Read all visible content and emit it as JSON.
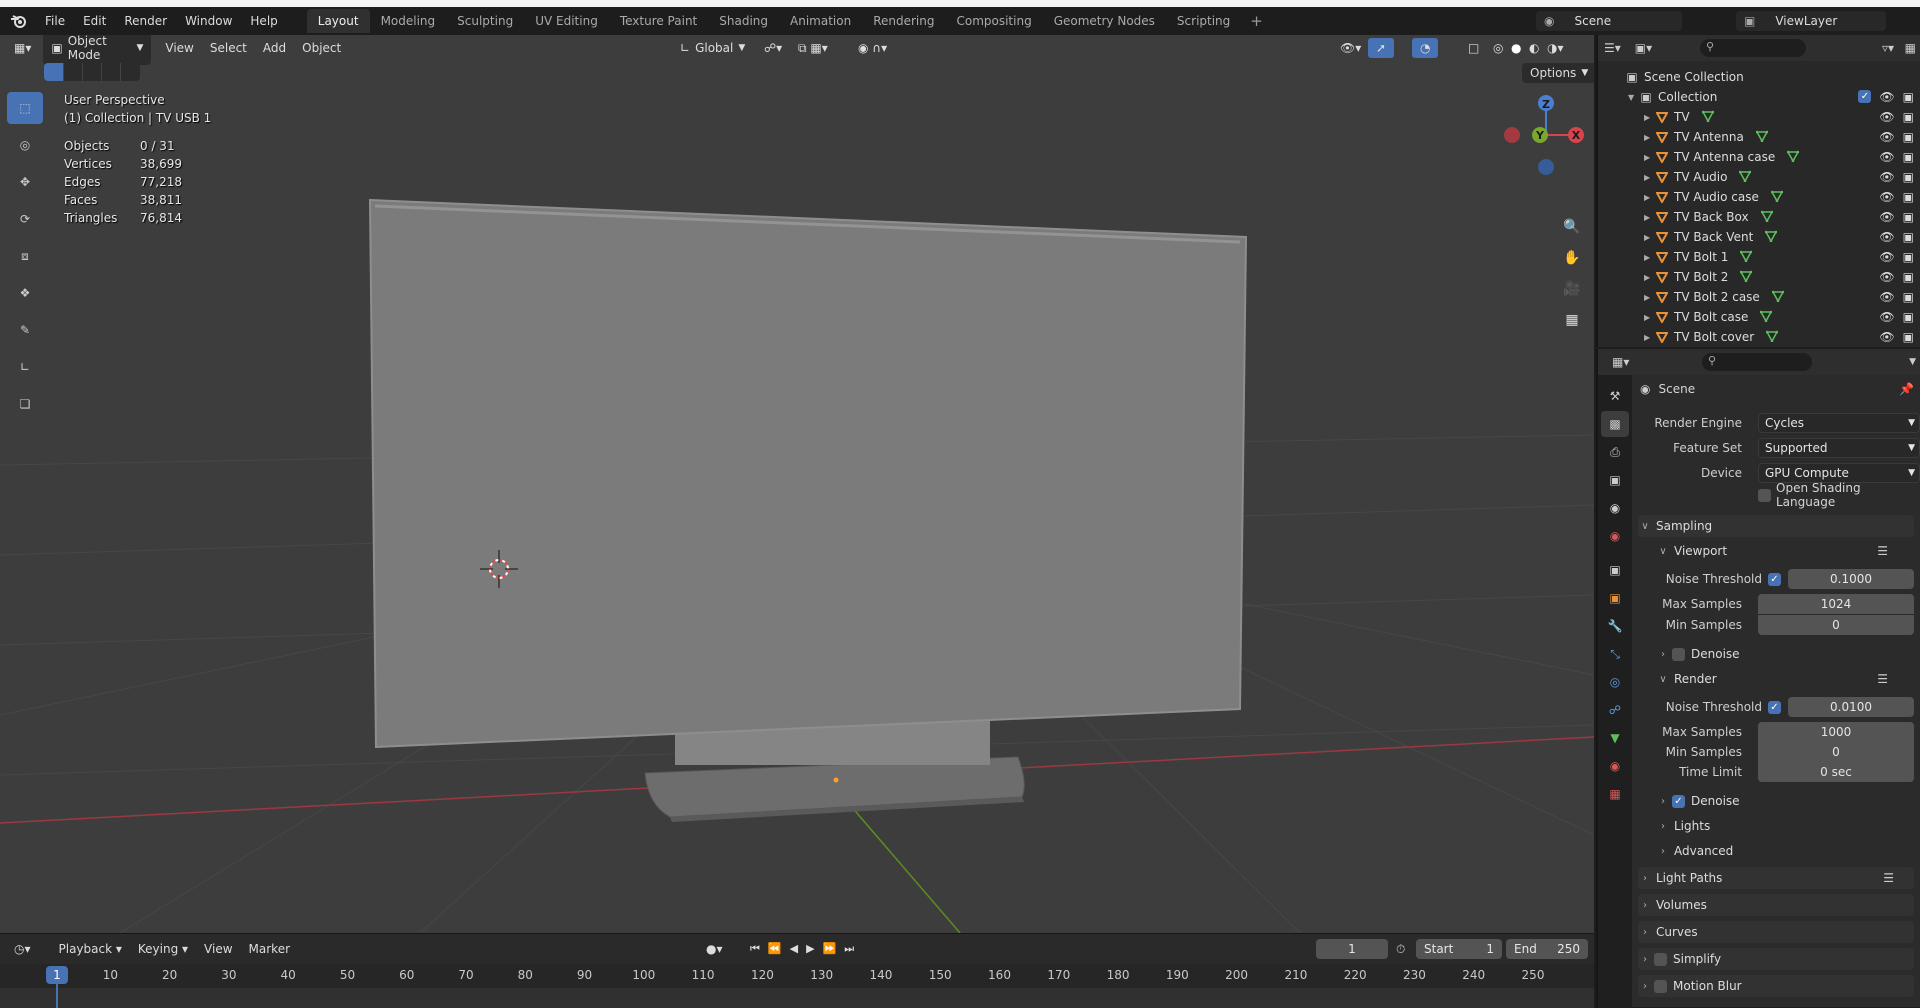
{
  "menubar": {
    "items": [
      "File",
      "Edit",
      "Render",
      "Window",
      "Help"
    ],
    "workspaces": [
      "Layout",
      "Modeling",
      "Sculpting",
      "UV Editing",
      "Texture Paint",
      "Shading",
      "Animation",
      "Rendering",
      "Compositing",
      "Geometry Nodes",
      "Scripting"
    ],
    "active_workspace": "Layout",
    "add_tab": "+",
    "scene": "Scene",
    "view_layer": "ViewLayer"
  },
  "viewport": {
    "mode": "Object Mode",
    "menus": [
      "View",
      "Select",
      "Add",
      "Object"
    ],
    "orientation": "Global",
    "options_label": "Options",
    "perspective": "User Perspective",
    "collection_label": "(1) Collection | TV USB 1",
    "stats": [
      {
        "label": "Objects",
        "value": "0 / 31"
      },
      {
        "label": "Vertices",
        "value": "38,699"
      },
      {
        "label": "Edges",
        "value": "77,218"
      },
      {
        "label": "Faces",
        "value": "38,811"
      },
      {
        "label": "Triangles",
        "value": "76,814"
      }
    ],
    "gizmo": {
      "z": "Z",
      "y": "Y",
      "x": "X"
    },
    "colors": {
      "background": "#3d3d3d",
      "x_axis": "#b5343e",
      "y_axis": "#6b9b22",
      "tv": "#7a7a7a"
    }
  },
  "timeline": {
    "menus": [
      "Playback",
      "Keying",
      "View",
      "Marker"
    ],
    "current_frame": "1",
    "start_label": "Start",
    "start": "1",
    "end_label": "End",
    "end": "250",
    "ticks": [
      "1",
      "10",
      "20",
      "30",
      "40",
      "50",
      "60",
      "70",
      "80",
      "90",
      "100",
      "110",
      "120",
      "130",
      "140",
      "150",
      "160",
      "170",
      "180",
      "190",
      "200",
      "210",
      "220",
      "230",
      "240",
      "250"
    ]
  },
  "outliner": {
    "scene_collection": "Scene Collection",
    "collection": "Collection",
    "items": [
      "TV",
      "TV Antenna",
      "TV Antenna case",
      "TV Audio",
      "TV Audio case",
      "TV Back Box",
      "TV Back Vent",
      "TV Bolt 1",
      "TV Bolt 2",
      "TV Bolt 2 case",
      "TV Bolt case",
      "TV Bolt cover"
    ]
  },
  "properties": {
    "context": "Scene",
    "render_engine_label": "Render Engine",
    "render_engine": "Cycles",
    "feature_set_label": "Feature Set",
    "feature_set": "Supported",
    "device_label": "Device",
    "device": "GPU Compute",
    "osl_label": "Open Shading Language",
    "sampling": "Sampling",
    "viewport_section": "Viewport",
    "noise_threshold_label": "Noise Threshold",
    "viewport_noise_threshold": "0.1000",
    "max_samples_label": "Max Samples",
    "viewport_max_samples": "1024",
    "min_samples_label": "Min Samples",
    "viewport_min_samples": "0",
    "denoise_label": "Denoise",
    "render_section": "Render",
    "render_noise_threshold": "0.0100",
    "render_max_samples": "1000",
    "render_min_samples": "0",
    "time_limit_label": "Time Limit",
    "time_limit": "0 sec",
    "lights": "Lights",
    "advanced": "Advanced",
    "light_paths": "Light Paths",
    "volumes": "Volumes",
    "curves": "Curves",
    "simplify": "Simplify",
    "motion_blur": "Motion Blur"
  }
}
